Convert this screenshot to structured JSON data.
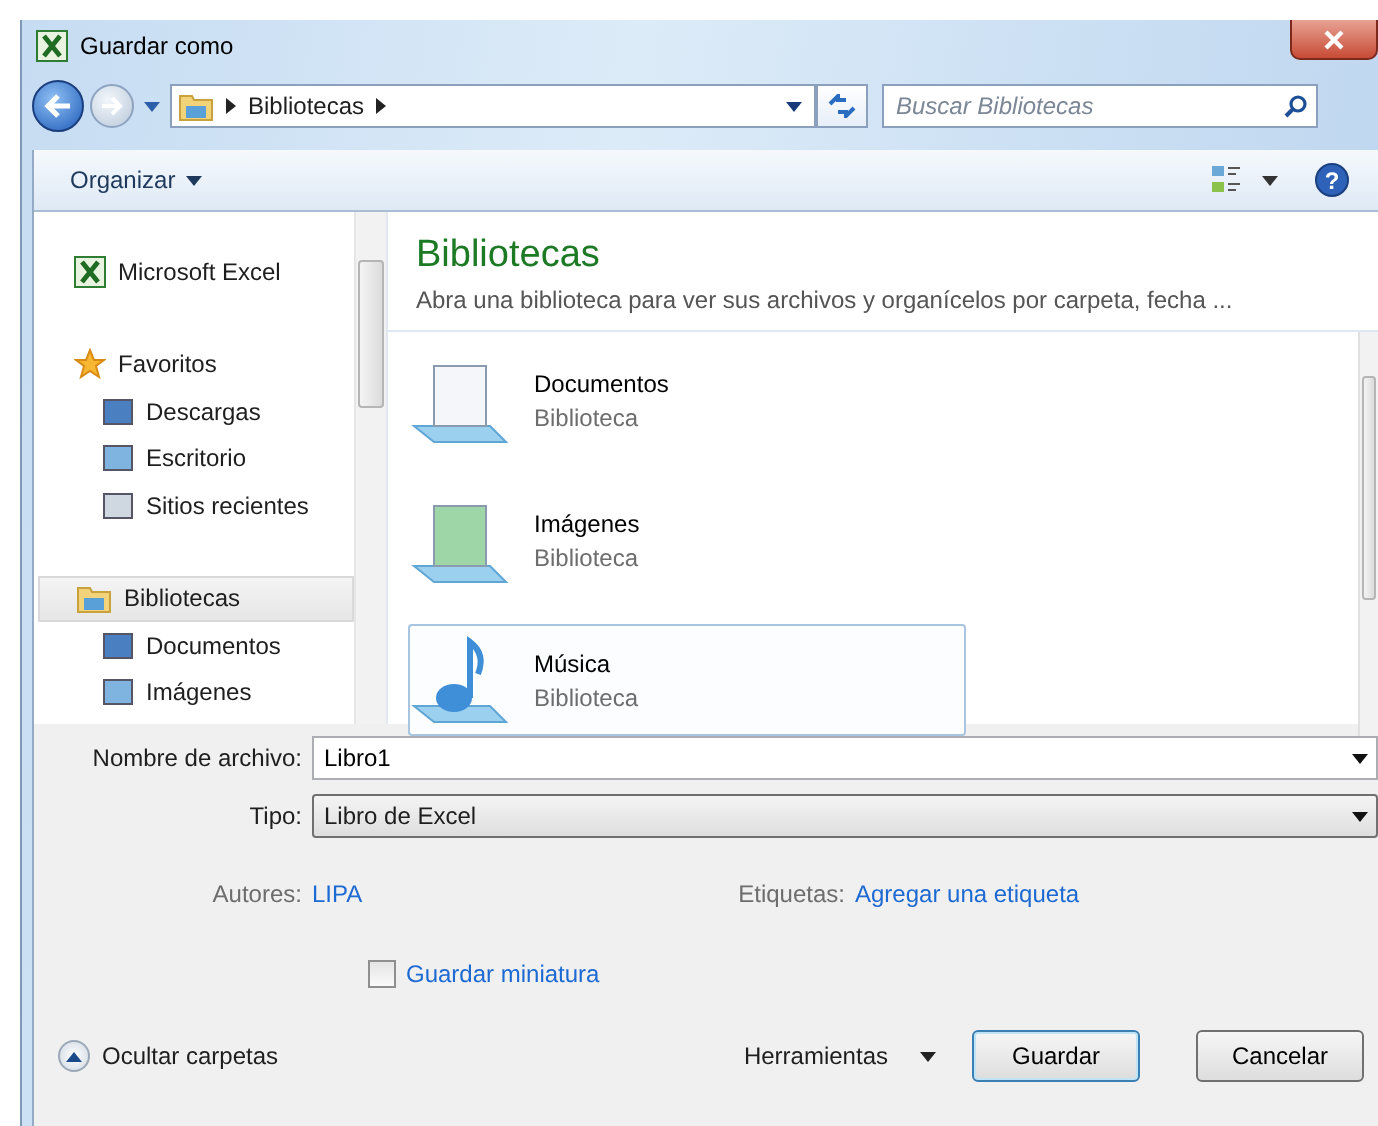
{
  "window": {
    "title": "Guardar como"
  },
  "address_bar": {
    "path": [
      "Bibliotecas"
    ],
    "search_placeholder": "Buscar Bibliotecas"
  },
  "toolbar": {
    "organize": "Organizar",
    "help": "?"
  },
  "sidebar": {
    "items": [
      {
        "label": "Microsoft Excel",
        "selected": false
      },
      {
        "label": "Favoritos",
        "selected": false,
        "children": [
          {
            "label": "Descargas",
            "selected": false
          },
          {
            "label": "Escritorio",
            "selected": false
          },
          {
            "label": "Sitios recientes",
            "selected": false
          }
        ]
      },
      {
        "label": "Bibliotecas",
        "selected": true,
        "children": [
          {
            "label": "Documentos",
            "selected": false
          },
          {
            "label": "Imágenes",
            "selected": false
          }
        ]
      }
    ]
  },
  "content": {
    "heading": "Bibliotecas",
    "subtitle": "Abra una biblioteca para ver sus archivos y organícelos por carpeta, fecha ...",
    "items": [
      {
        "name": "Documentos",
        "type": "Biblioteca",
        "selected": false
      },
      {
        "name": "Imágenes",
        "type": "Biblioteca",
        "selected": false
      },
      {
        "name": "Música",
        "type": "Biblioteca",
        "selected": true
      }
    ]
  },
  "form": {
    "filename_label": "Nombre de archivo:",
    "filename": "Libro1",
    "type_label": "Tipo:",
    "type": "Libro de Excel",
    "authors_label": "Autores:",
    "authors": "LIPA",
    "tags_label": "Etiquetas:",
    "tags": "Agregar una etiqueta",
    "thumbnail": {
      "label": "Guardar miniatura",
      "checked": false
    }
  },
  "footer": {
    "hide_folders": "Ocultar carpetas",
    "tools": "Herramientas",
    "save": "Guardar",
    "cancel": "Cancelar"
  }
}
